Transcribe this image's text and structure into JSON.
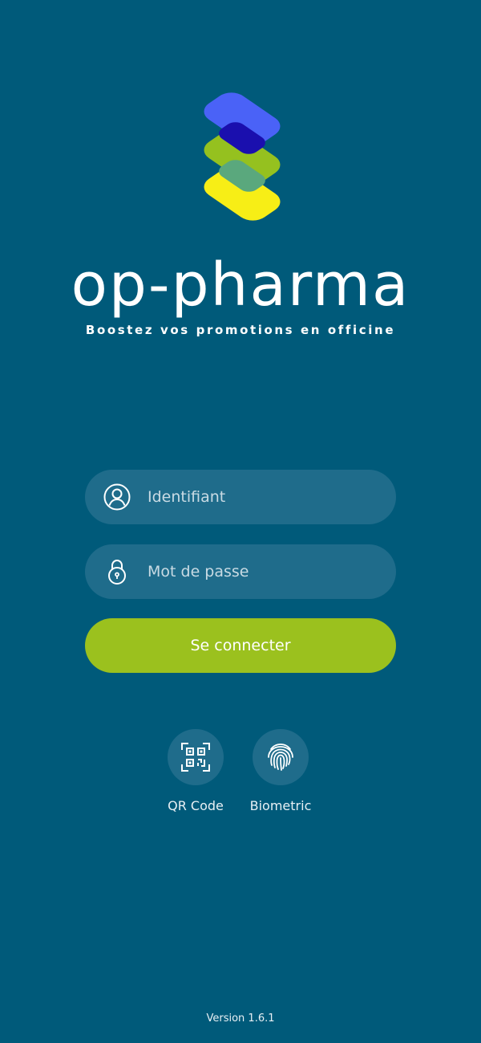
{
  "brand": {
    "name": "op-pharma",
    "tagline": "Boostez vos promotions en officine",
    "colors": {
      "background": "#005a7a",
      "accent_green": "#9bc11e",
      "logo_blue": "#4a62f7",
      "logo_green": "#95c11f",
      "logo_yellow": "#f7ee16"
    }
  },
  "form": {
    "username": {
      "placeholder": "Identifiant",
      "value": "",
      "icon": "user-circle-icon"
    },
    "password": {
      "placeholder": "Mot de passe",
      "value": "",
      "icon": "padlock-icon"
    },
    "submit_label": "Se connecter"
  },
  "alt_login": [
    {
      "label": "QR Code",
      "icon": "qr-code-icon"
    },
    {
      "label": "Biometric",
      "icon": "fingerprint-icon"
    }
  ],
  "footer": {
    "version": "Version 1.6.1"
  }
}
